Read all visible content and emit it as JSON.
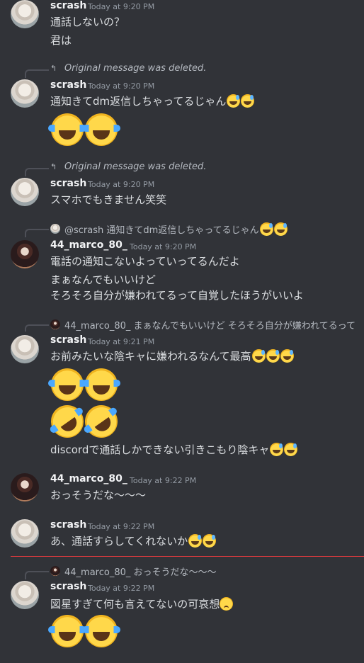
{
  "messages": [
    {
      "author": "scrash",
      "time": "Today at 9:20 PM",
      "lines": [
        "通話しないの？",
        "君は"
      ]
    },
    {
      "reply": {
        "text": "Original message was deleted."
      },
      "author": "scrash",
      "time": "Today at 9:20 PM",
      "lines": [
        "通知きてdm返信しちゃってるじゃん"
      ]
    },
    {
      "reply": {
        "text": "Original message was deleted."
      },
      "author": "scrash",
      "time": "Today at 9:20 PM",
      "lines": [
        "スマホでもきません笑笑"
      ]
    },
    {
      "reply": {
        "name": "@scrash",
        "text": "通知きてdm返信しちゃってるじゃん"
      },
      "author": "44_marco_80_",
      "time": "Today at 9:20 PM",
      "lines": [
        "電話の通知こないよっていってるんだよ",
        "まぁなんでもいいけど",
        "そろそろ自分が嫌われてるって自覚したほうがいいよ"
      ]
    },
    {
      "reply": {
        "name": "44_marco_80_",
        "text": "まぁなんでもいいけど そろそろ自分が嫌われてるって"
      },
      "author": "scrash",
      "time": "Today at 9:21 PM",
      "lines": [
        "お前みたいな陰キャに嫌われるなんて最高",
        "discordで通話しかできない引きこもり陰キャ"
      ]
    },
    {
      "author": "44_marco_80_",
      "time": "Today at 9:22 PM",
      "lines": [
        "おっそうだな〜〜〜"
      ]
    },
    {
      "author": "scrash",
      "time": "Today at 9:22 PM",
      "lines": [
        "あ、通話すらしてくれないか"
      ]
    },
    {
      "reply": {
        "name": "44_marco_80_",
        "text": "おっそうだな〜〜〜"
      },
      "author": "scrash",
      "time": "Today at 9:22 PM",
      "lines": [
        "図星すぎて何も言えてないの可哀想"
      ]
    }
  ]
}
